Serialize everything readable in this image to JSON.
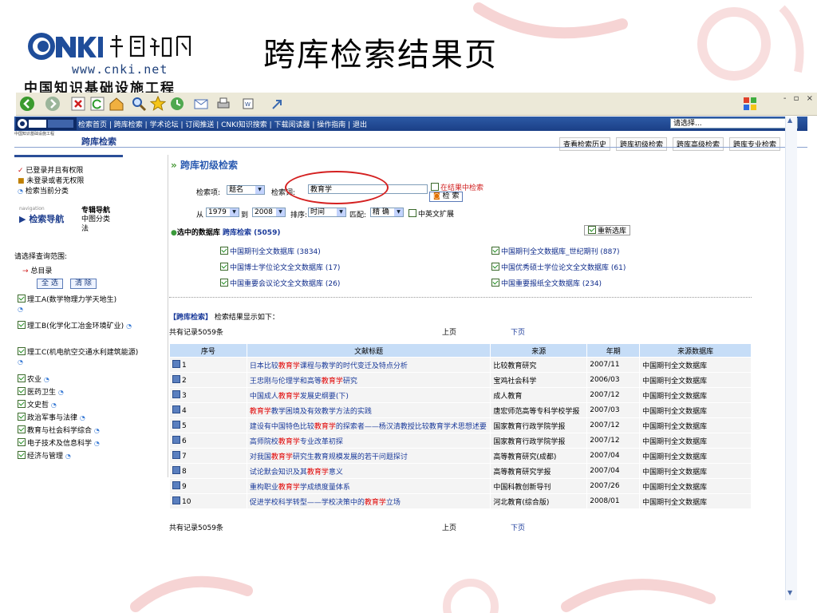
{
  "logo": {
    "url_text": "www.cnki.net",
    "org_text": "中国知识基础设施工程"
  },
  "slide_title": "跨库检索结果页",
  "nav": {
    "links": [
      "检索首页",
      "跨库检索",
      "学术论坛",
      "订阅推送",
      "CNKI知识搜索",
      "下载阅读器",
      "操作指南",
      "退出"
    ],
    "select_value": "请选择..."
  },
  "subheader": {
    "title": "跨库检索",
    "tabs": [
      "查看检索历史",
      "跨库初级检索",
      "跨库高级检索",
      "跨库专业检索"
    ]
  },
  "sidebar": {
    "status": [
      "已登录并且有权限",
      "未登录或者无权限",
      "检索当前分类"
    ],
    "nav_small": "navigation",
    "nav_title": "检索导航",
    "nav_links": [
      "专辑导航",
      "中图分类法"
    ],
    "scope_label": "请选择查询范围:",
    "root_label": "总目录",
    "select_all": "全 选",
    "clear": "清 除",
    "categories": [
      "理工A(数学物理力学天地生)",
      "理工B(化学化工冶金环境矿业)",
      "理工C(机电航空交通水利建筑能源)",
      "农业",
      "医药卫生",
      "文史哲",
      "政治军事与法律",
      "教育与社会科学综合",
      "电子技术及信息科学",
      "经济与管理"
    ]
  },
  "search": {
    "section_title": "跨库初级检索",
    "field_label": "检索项:",
    "field_value": "题名",
    "term_label": "检索词:",
    "term_value": "教育学",
    "in_results_label": "在结果中检索",
    "search_button": "检 索",
    "from_label": "从",
    "from_year": "1979",
    "to_label": "到",
    "to_year": "2008",
    "sort_label": "排序",
    "sort_value": "时间",
    "match_label": "匹配",
    "match_value": "精 确",
    "cn_en_label": "中英文扩展"
  },
  "databases": {
    "header_label": "选中的数据库",
    "header_link": "跨库检索",
    "header_count": "(5059)",
    "reselect": "重新选库",
    "left": [
      "中国期刊全文数据库 (3834)",
      "中国博士学位论文全文数据库 (17)",
      "中国重要会议论文全文数据库 (26)"
    ],
    "right": [
      "中国期刊全文数据库_世纪期刊 (887)",
      "中国优秀硕士学位论文全文数据库 (61)",
      "中国重要报纸全文数据库 (234)"
    ]
  },
  "results": {
    "heading_bracket": "【跨库检索】",
    "heading_text": "检索结果显示如下：",
    "total": "共有记录5059条",
    "prev": "上页",
    "next": "下页",
    "columns": [
      "序号",
      "文献标题",
      "来源",
      "年期",
      "来源数据库"
    ],
    "rows": [
      {
        "no": "1",
        "pre": "日本比较",
        "hl": "教育学",
        "post": "课程与教学的时代变迁及特点分析",
        "source": "比较教育研究",
        "issue": "2007/11",
        "db": "中国期刊全文数据库"
      },
      {
        "no": "2",
        "pre": "王忠刚与伦理学和高等",
        "hl": "教育学",
        "post": "研究",
        "source": "宝鸡社会科学",
        "issue": "2006/03",
        "db": "中国期刊全文数据库"
      },
      {
        "no": "3",
        "pre": "中国成人",
        "hl": "教育学",
        "post": "发展史纲要(下)",
        "source": "成人教育",
        "issue": "2007/12",
        "db": "中国期刊全文数据库"
      },
      {
        "no": "4",
        "pre": "",
        "hl": "教育学",
        "post": "教学困境及有效教学方法的实践",
        "source": "唐宏师范高等专科学校学报",
        "issue": "2007/03",
        "db": "中国期刊全文数据库"
      },
      {
        "no": "5",
        "pre": "建设有中国特色比较",
        "hl": "教育学",
        "post": "的探索者——杨汉清教授比较教育学术思想述要",
        "source": "国家教育行政学院学报",
        "issue": "2007/12",
        "db": "中国期刊全文数据库"
      },
      {
        "no": "6",
        "pre": "高师院校",
        "hl": "教育学",
        "post": "专业改革初探",
        "source": "国家教育行政学院学报",
        "issue": "2007/12",
        "db": "中国期刊全文数据库"
      },
      {
        "no": "7",
        "pre": "对我国",
        "hl": "教育学",
        "post": "研究生教育规模发展的若干问题探讨",
        "source": "高等教育研究(成都)",
        "issue": "2007/04",
        "db": "中国期刊全文数据库"
      },
      {
        "no": "8",
        "pre": "试论默会知识及其",
        "hl": "教育学",
        "post": "意义",
        "source": "高等教育研究学报",
        "issue": "2007/04",
        "db": "中国期刊全文数据库"
      },
      {
        "no": "9",
        "pre": "重构职业",
        "hl": "教育学",
        "post": "学成绩度量体系",
        "source": "中国科教创新导刊",
        "issue": "2007/26",
        "db": "中国期刊全文数据库"
      },
      {
        "no": "10",
        "pre": "促进学校科学转型——学校决策中的",
        "hl": "教育学",
        "post": "立场",
        "source": "河北教育(综合版)",
        "issue": "2008/01",
        "db": "中国期刊全文数据库"
      }
    ]
  }
}
